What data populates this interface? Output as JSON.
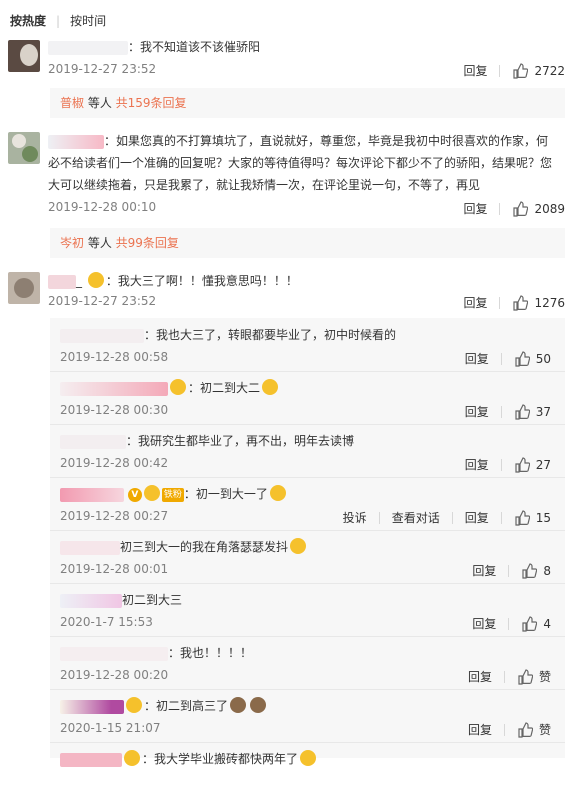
{
  "tabs": {
    "hot": "按热度",
    "time": "按时间"
  },
  "labels": {
    "reply": "回复",
    "report": "投诉",
    "view_conv": "查看对话",
    "like": "赞",
    "others": " 等人 "
  },
  "comments": [
    {
      "text": "：我不知道该不该催骄阳",
      "date": "2019-12-27 23:52",
      "likes": "2722",
      "reply_user": "普椒",
      "reply_count": "共159条回复"
    },
    {
      "text": "：如果您真的不打算填坑了，直说就好，尊重您，毕竟是我初中时很喜欢的作家，何必不给读者们一个准确的回复呢？大家的等待值得吗？每次评论下都少不了的骄阳，结果呢？您大可以继续拖着，只是我累了，就让我矫情一次，在评论里说一句，不等了，再见",
      "date": "2019-12-28 00:10",
      "likes": "2089",
      "reply_user": "岑初",
      "reply_count": "共99条回复"
    },
    {
      "name_prefix": "_",
      "text": "：我大三了啊！！懂我意思吗！！！",
      "date": "2019-12-27 23:52",
      "likes": "1276"
    }
  ],
  "subreplies": [
    {
      "text": "：我也大三了，转眼都要毕业了，初中时候看的",
      "date": "2019-12-28 00:58",
      "likes": "50"
    },
    {
      "text": "：初二到大二",
      "date": "2019-12-28 00:30",
      "likes": "37"
    },
    {
      "text": "：我研究生都毕业了，再不出，明年去读博",
      "date": "2019-12-28 00:42",
      "likes": "27"
    },
    {
      "text": "：初一到大一了",
      "date": "2019-12-28 00:27",
      "likes": "15"
    },
    {
      "text": "初三到大一的我在角落瑟瑟发抖",
      "date": "2019-12-28 00:01",
      "likes": "8"
    },
    {
      "text": "初二到大三",
      "date": "2020-1-7 15:53",
      "likes": "4"
    },
    {
      "text": "：我也！！！！",
      "date": "2019-12-28 00:20",
      "likes": "赞"
    },
    {
      "text": "：初二到高三了",
      "date": "2020-1-15 21:07",
      "likes": "赞"
    },
    {
      "text": "：我大学毕业搬砖都快两年了"
    }
  ],
  "badge_text": "铁粉"
}
